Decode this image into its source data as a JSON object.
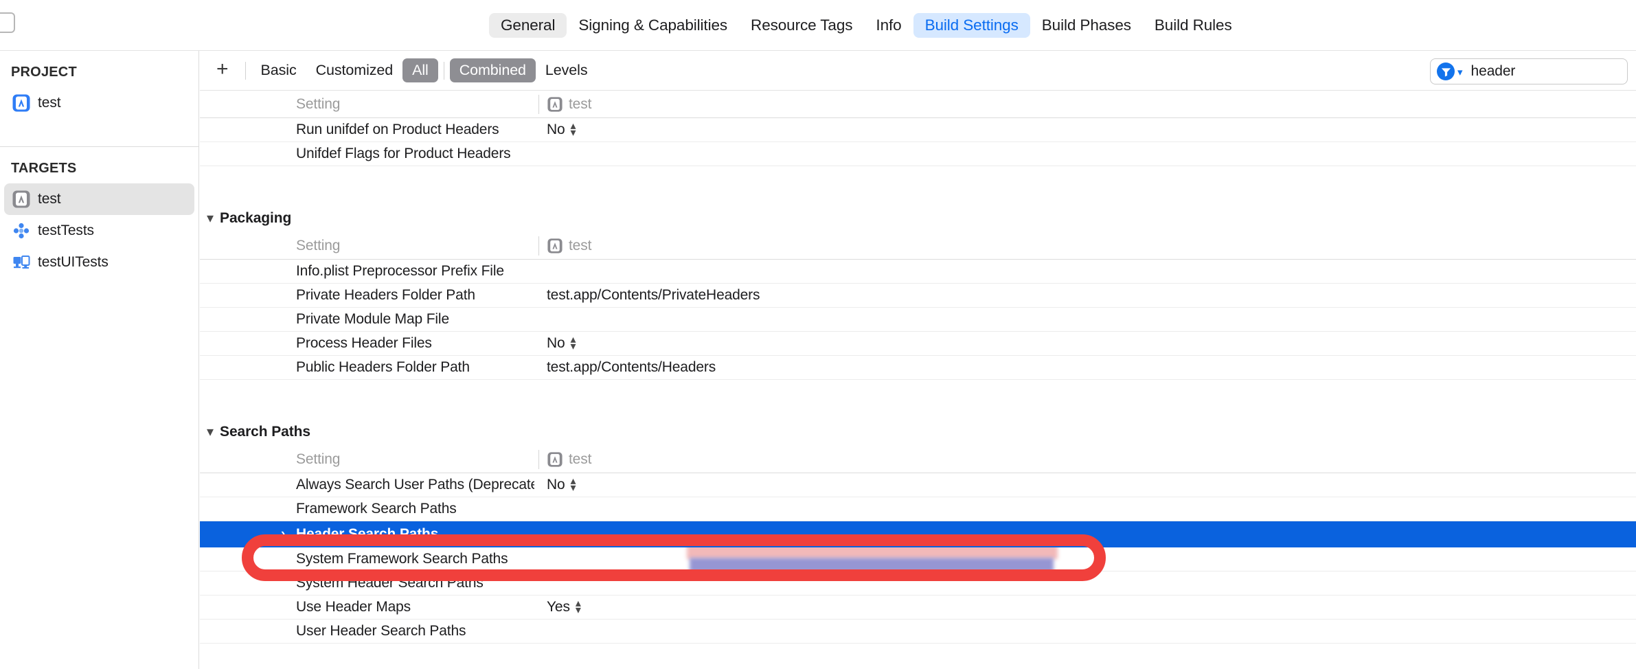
{
  "window": {
    "top_left_icon": "document-icon"
  },
  "tabs": [
    {
      "label": "General",
      "state": "hover"
    },
    {
      "label": "Signing & Capabilities",
      "state": "normal"
    },
    {
      "label": "Resource Tags",
      "state": "normal"
    },
    {
      "label": "Info",
      "state": "normal"
    },
    {
      "label": "Build Settings",
      "state": "active"
    },
    {
      "label": "Build Phases",
      "state": "normal"
    },
    {
      "label": "Build Rules",
      "state": "normal"
    }
  ],
  "sidebar": {
    "project_header": "PROJECT",
    "project_items": [
      {
        "label": "test",
        "icon": "app-icon-blue"
      }
    ],
    "targets_header": "TARGETS",
    "target_items": [
      {
        "label": "test",
        "icon": "app-icon-gray",
        "selected": true
      },
      {
        "label": "testTests",
        "icon": "unit-test-icon",
        "selected": false
      },
      {
        "label": "testUITests",
        "icon": "ui-test-icon",
        "selected": false
      }
    ]
  },
  "toolbar": {
    "add_label": "+",
    "basic_label": "Basic",
    "customized_label": "Customized",
    "all_label": "All",
    "combined_label": "Combined",
    "levels_label": "Levels",
    "active_filters": [
      "All",
      "Combined"
    ]
  },
  "search": {
    "value": "header",
    "placeholder": "",
    "icon": "filter-funnel-icon"
  },
  "table": {
    "setting_column_header": "Setting",
    "target_column_header": "test",
    "target_column_icon": "app-icon-gray"
  },
  "sections": [
    {
      "name": "",
      "show_title": false,
      "rows": [
        {
          "setting": "Run unifdef on Product Headers",
          "value": "No",
          "control": "stepper"
        },
        {
          "setting": "Unifdef Flags for Product Headers",
          "value": "",
          "control": "none"
        }
      ]
    },
    {
      "name": "Packaging",
      "show_title": true,
      "rows": [
        {
          "setting": "Info.plist Preprocessor Prefix File",
          "value": "",
          "control": "none"
        },
        {
          "setting": "Private Headers Folder Path",
          "value": "test.app/Contents/PrivateHeaders",
          "control": "none"
        },
        {
          "setting": "Private Module Map File",
          "value": "",
          "control": "none"
        },
        {
          "setting": "Process Header Files",
          "value": "No",
          "control": "stepper"
        },
        {
          "setting": "Public Headers Folder Path",
          "value": "test.app/Contents/Headers",
          "control": "none"
        }
      ]
    },
    {
      "name": "Search Paths",
      "show_title": true,
      "rows": [
        {
          "setting": "Always Search User Paths (Deprecated)",
          "value": "No",
          "control": "stepper"
        },
        {
          "setting": "Framework Search Paths",
          "value": "",
          "control": "none",
          "obscured": true
        },
        {
          "setting": "Header Search Paths",
          "value": "",
          "control": "none",
          "selected": true,
          "expandable": true,
          "value_redacted": true
        },
        {
          "setting": "System Framework Search Paths",
          "value": "",
          "control": "none"
        },
        {
          "setting": "System Header Search Paths",
          "value": "",
          "control": "none"
        },
        {
          "setting": "Use Header Maps",
          "value": "Yes",
          "control": "stepper"
        },
        {
          "setting": "User Header Search Paths",
          "value": "",
          "control": "none"
        }
      ]
    }
  ],
  "annotation": {
    "type": "red-rounded-rectangle-highlight",
    "color": "#f0403c",
    "targets_row": "Header Search Paths"
  },
  "colors": {
    "selection_blue": "#0a62de",
    "tab_active_bg": "#d6e8ff",
    "tab_active_text": "#0a6cf1",
    "filter_on_bg": "#8e8e93",
    "annotation_red": "#f0403c",
    "sidebar_selected_bg": "#e4e4e4"
  }
}
